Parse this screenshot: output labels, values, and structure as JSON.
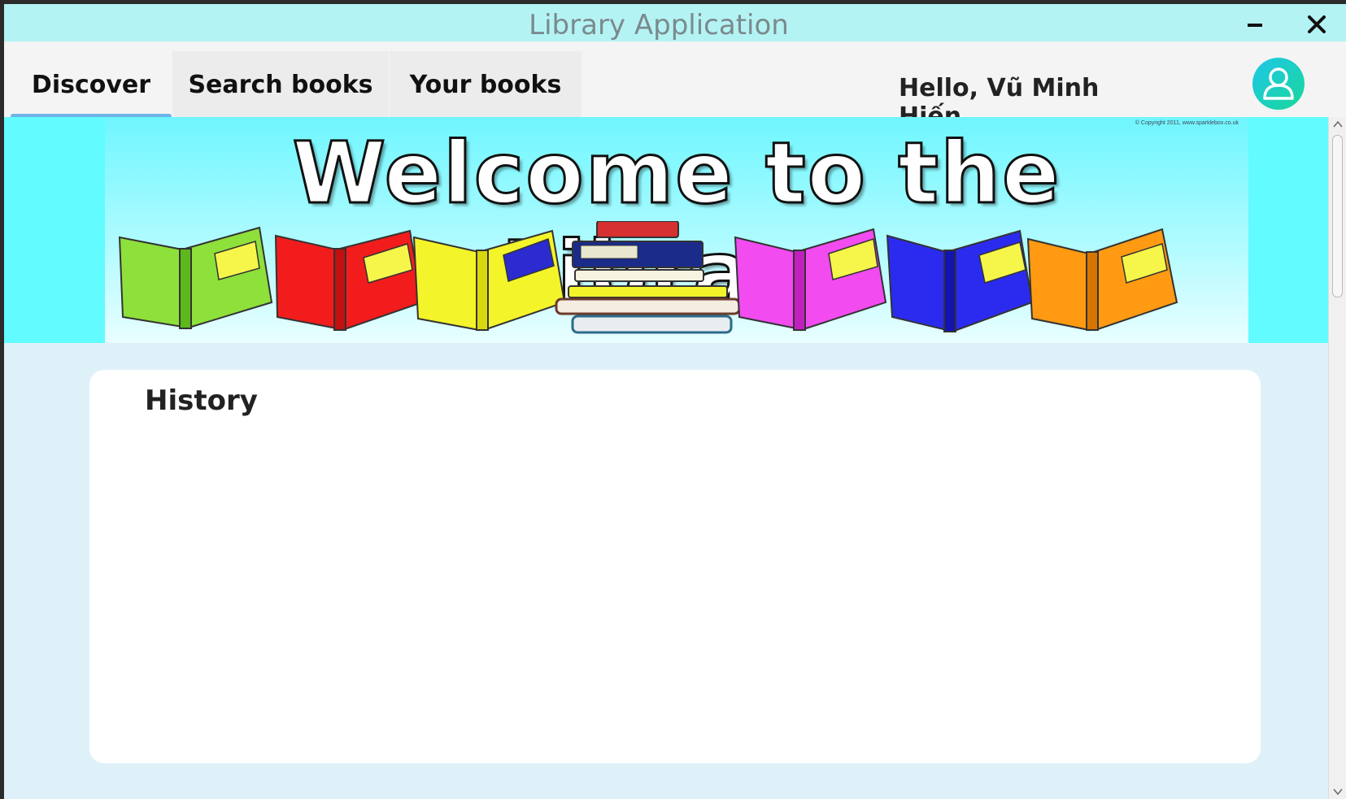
{
  "window": {
    "title": "Library Application"
  },
  "tabs": [
    {
      "label": "Discover",
      "active": true
    },
    {
      "label": "Search books",
      "active": false
    },
    {
      "label": "Your books",
      "active": false
    }
  ],
  "header": {
    "greeting": "Hello, Vũ Minh Hiến",
    "avatar_icon": "user-avatar-icon"
  },
  "banner": {
    "title": "Welcome to the Library",
    "copyright": "© Copyright 2011, www.sparklebox.co.uk",
    "book_colors": [
      "#8ee03a",
      "#f21c1c",
      "#f4f42a",
      "#f24bf0",
      "#2b2bf0",
      "#ff9a12"
    ]
  },
  "main": {
    "history_title": "History"
  },
  "colors": {
    "titlebar": "#b4f3f4",
    "banner_strip": "#62fbff",
    "tab_underline": "#6fb4e8",
    "content_bg": "#dff1f8"
  }
}
